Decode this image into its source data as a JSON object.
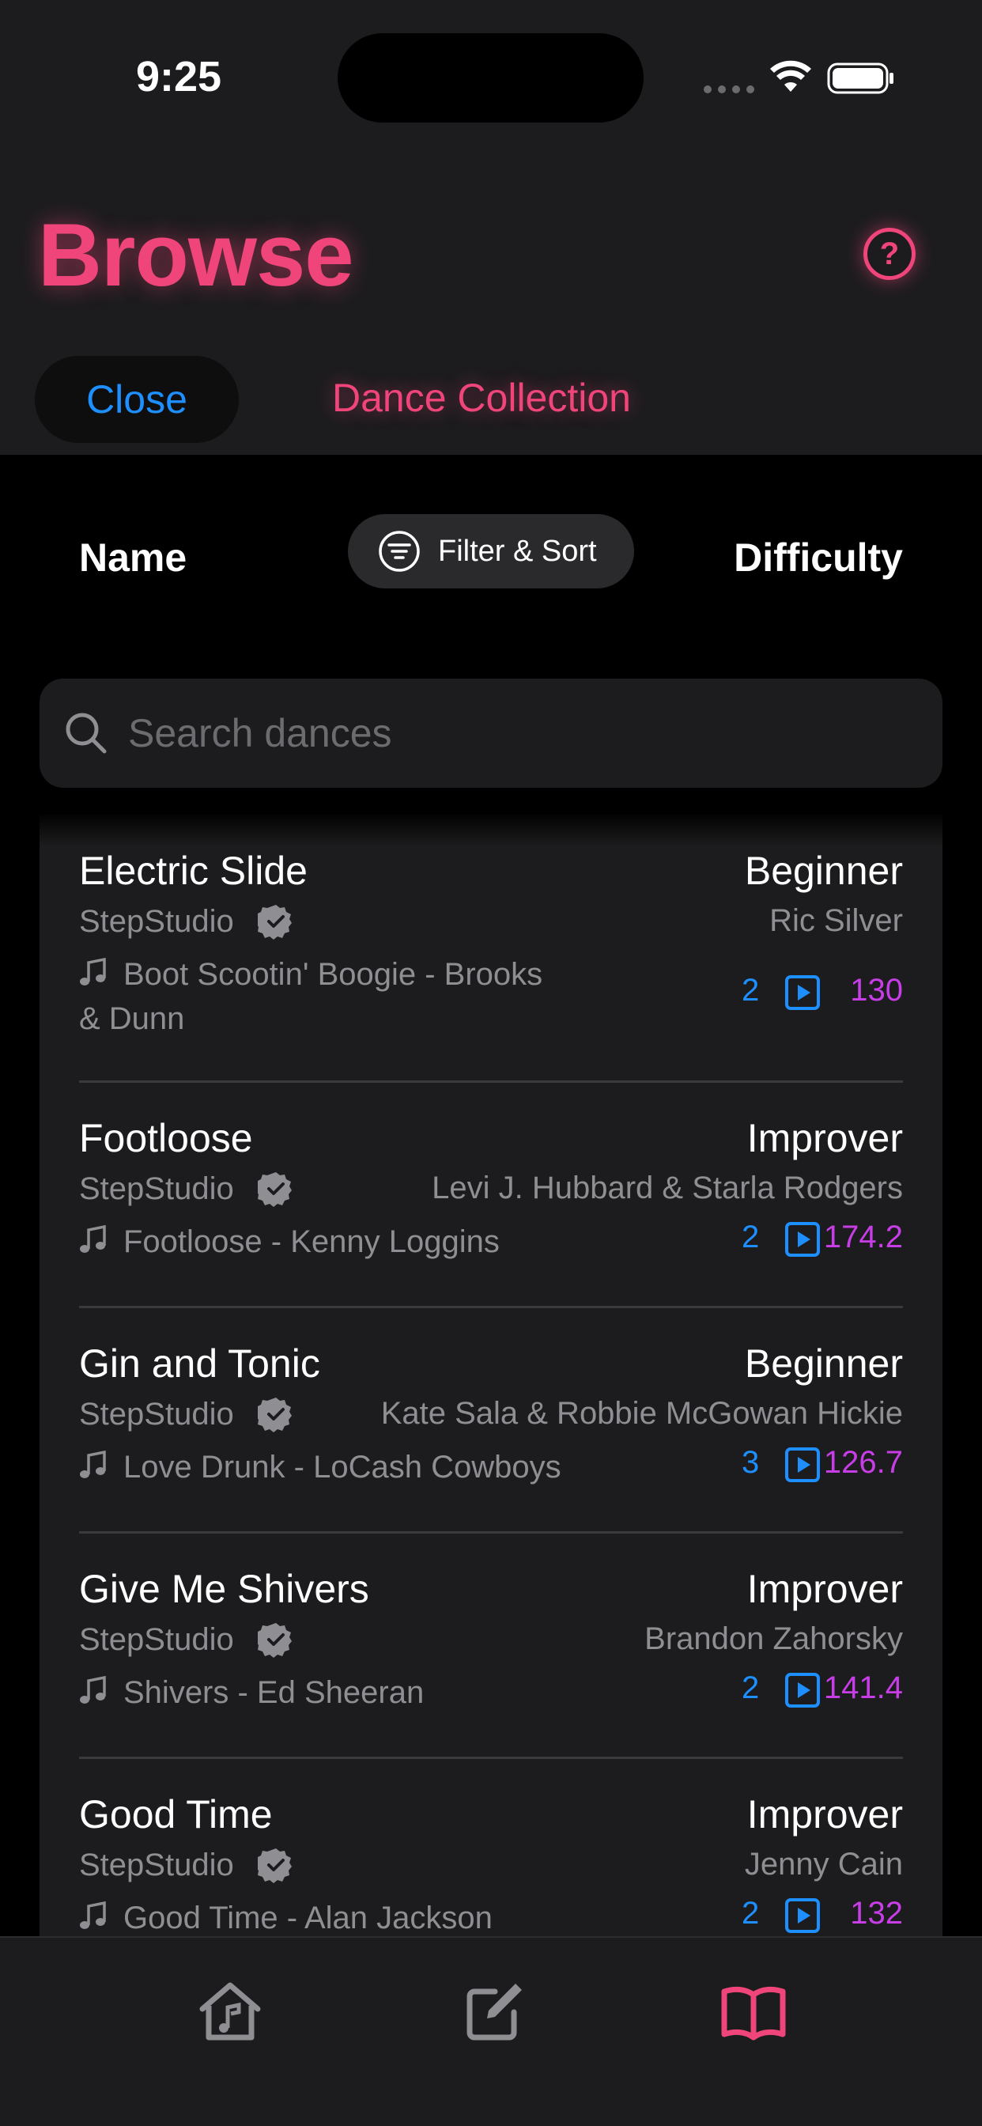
{
  "status_bar": {
    "time": "9:25"
  },
  "header": {
    "title": "Browse",
    "help_symbol": "?",
    "close_label": "Close",
    "collection_label": "Dance Collection"
  },
  "sort_bar": {
    "name_label": "Name",
    "filter_label": "Filter & Sort",
    "difficulty_label": "Difficulty"
  },
  "search": {
    "placeholder": "Search dances",
    "value": ""
  },
  "dances": [
    {
      "name": "Electric Slide",
      "difficulty": "Beginner",
      "studio": "StepStudio",
      "choreographer": "Ric Silver",
      "song_line1": "Boot Scootin' Boogie - Brooks",
      "song_line2": "& Dunn",
      "count": "2",
      "bpm": "130"
    },
    {
      "name": "Footloose",
      "difficulty": "Improver",
      "studio": "StepStudio",
      "choreographer": "Levi J. Hubbard & Starla Rodgers",
      "song_line1": "Footloose - Kenny Loggins",
      "song_line2": "",
      "count": "2",
      "bpm": "174.2"
    },
    {
      "name": "Gin and Tonic",
      "difficulty": "Beginner",
      "studio": "StepStudio",
      "choreographer": "Kate Sala & Robbie McGowan Hickie",
      "song_line1": "Love Drunk - LoCash Cowboys",
      "song_line2": "",
      "count": "3",
      "bpm": "126.7"
    },
    {
      "name": "Give Me Shivers",
      "difficulty": "Improver",
      "studio": "StepStudio",
      "choreographer": "Brandon Zahorsky",
      "song_line1": "Shivers - Ed Sheeran",
      "song_line2": "",
      "count": "2",
      "bpm": "141.4"
    },
    {
      "name": "Good Time",
      "difficulty": "Improver",
      "studio": "StepStudio",
      "choreographer": "Jenny Cain",
      "song_line1": "Good Time - Alan Jackson",
      "song_line2": "",
      "count": "2",
      "bpm": "132"
    }
  ],
  "icons": {
    "verified": "verified-badge-icon",
    "note": "music-note-icon",
    "play": "play-square-icon",
    "tabs": [
      "home-music-icon",
      "edit-icon",
      "book-icon"
    ]
  },
  "colors": {
    "accent_pink": "#f0457a",
    "link_blue": "#1e8fff",
    "bpm_purple": "#c83ee6",
    "background": "#000000",
    "surface": "#1c1c1e"
  }
}
